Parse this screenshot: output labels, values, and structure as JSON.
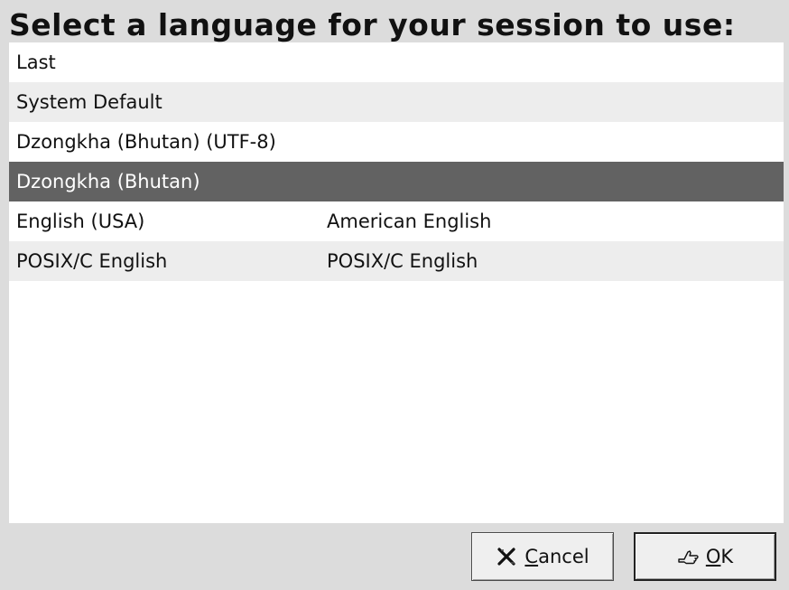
{
  "dialog": {
    "title": "Select a language for your session to use:"
  },
  "list": {
    "rows": [
      {
        "col1": "Last",
        "col2": ""
      },
      {
        "col1": "System Default",
        "col2": ""
      },
      {
        "col1": "Dzongkha (Bhutan) (UTF-8)",
        "col2": ""
      },
      {
        "col1": "Dzongkha (Bhutan)",
        "col2": "",
        "selected": true
      },
      {
        "col1": "English (USA)",
        "col2": "American English"
      },
      {
        "col1": "POSIX/C English",
        "col2": "POSIX/C English"
      }
    ]
  },
  "buttons": {
    "cancel_mnemonic": "C",
    "cancel_rest": "ancel",
    "ok_mnemonic": "O",
    "ok_rest": "K"
  },
  "colors": {
    "selected_row": "#626262",
    "alt_row": "#ededed",
    "background": "#dcdcdc"
  },
  "icons": {
    "cancel": "cancel-x-icon",
    "ok": "ok-hand-icon"
  }
}
